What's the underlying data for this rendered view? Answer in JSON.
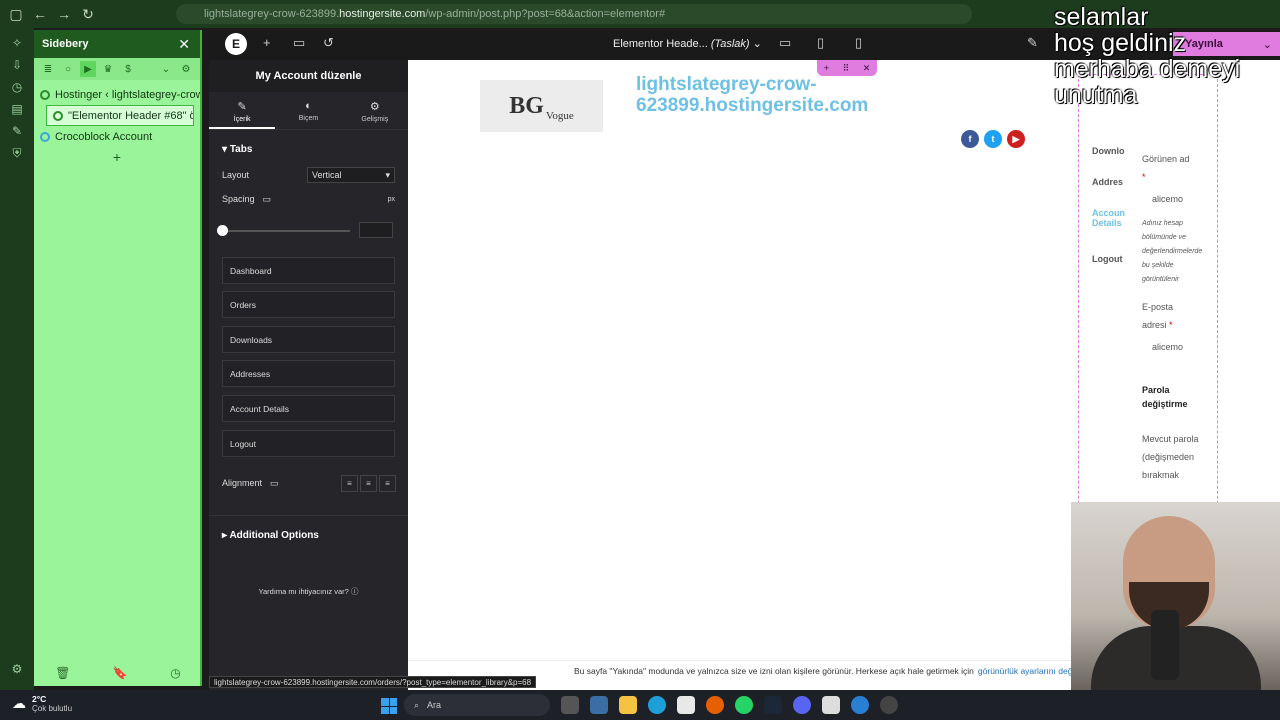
{
  "browser": {
    "url_prefix": "lightslategrey-crow-623899.",
    "url_host": "hostingersite.com",
    "url_path": "/wp-admin/post.php?post=68&action=elementor#"
  },
  "sidebery": {
    "title": "Sidebery",
    "tabs": [
      {
        "label": "Hostinger ‹ lightslategrey-crow-6"
      },
      {
        "label": "\"Elementor Header #68\" öğesi"
      },
      {
        "label": "Crocoblock Account"
      }
    ],
    "add_label": "+"
  },
  "elementor_top": {
    "doc_title": "Elementor Heade...",
    "doc_status": "(Taslak)",
    "publish_label": "Yayınla"
  },
  "panel": {
    "title": "My Account düzenle",
    "tabs": [
      {
        "label": "İçerik",
        "glyph": "✎"
      },
      {
        "label": "Biçem",
        "glyph": "◐"
      },
      {
        "label": "Gelişmiş",
        "glyph": "⚙"
      }
    ],
    "section_tabs": "Tabs",
    "layout_label": "Layout",
    "layout_value": "Vertical",
    "spacing_label": "Spacing",
    "spacing_unit": "px",
    "items": [
      "Dashboard",
      "Orders",
      "Downloads",
      "Addresses",
      "Account Details",
      "Logout"
    ],
    "alignment_label": "Alignment",
    "additional_label": "Additional Options",
    "help_label": "Yardıma mı ihtiyacınız var?"
  },
  "canvas": {
    "site_url": "lightslategrey-crow-623899.hostingersite.com",
    "logo_text": "BG",
    "logo_sub": "Vogue",
    "account_nav": [
      "Downlo",
      "Addres",
      "Accoun\nDetails",
      "Logout"
    ],
    "form": {
      "display_name_label": "Görünen ad",
      "display_name_value": "alicemo",
      "display_name_hint": "Adınız hesap bölümünde ve değerlendirmelerde bu şekilde görüntülenir",
      "email_label": "E-posta adresi",
      "email_value": "alicemo",
      "password_heading": "Parola değiştirme",
      "current_password": "Mevcut parola (değişmeden bırakmak"
    },
    "footer_text": "Bu sayfa \"Yakında\" modunda ve yalnızca size ve izni olan kişilere görünür. Herkese açık hale getirmek için",
    "footer_link": "görünürlük ayarlarını değ"
  },
  "status_link": "lightslategrey-crow-623899.hostingersite.com/orders/?post_type=elementor_library&p=68",
  "overlay_text": [
    "selamlar",
    "hoş geldiniz",
    "merhaba demeyi",
    "unutma"
  ],
  "taskbar": {
    "temp": "2°C",
    "weather": "Çok bulutlu",
    "search_placeholder": "Ara"
  },
  "colors": {
    "sidebery_bg": "#9af59a",
    "accent_pink": "#e07be0",
    "link_blue": "#6ec1e4"
  }
}
